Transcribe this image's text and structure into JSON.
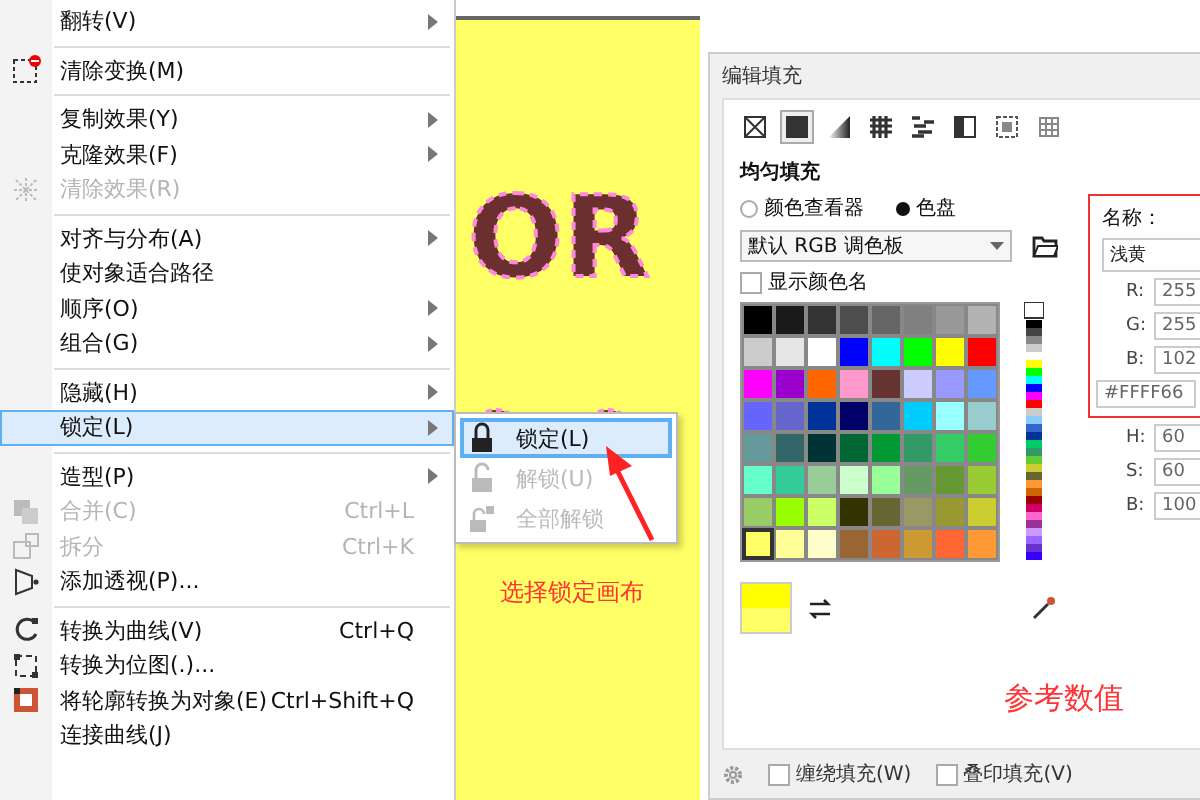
{
  "menu": {
    "groups": [
      [
        {
          "label": "翻转(V)",
          "submenu": true,
          "disabled": false,
          "selected": false
        }
      ],
      [
        {
          "label": "清除变换(M)",
          "submenu": false,
          "disabled": false,
          "selected": false
        }
      ],
      [
        {
          "label": "复制效果(Y)",
          "submenu": true,
          "disabled": false,
          "selected": false
        },
        {
          "label": "克隆效果(F)",
          "submenu": true,
          "disabled": false,
          "selected": false
        },
        {
          "label": "清除效果(R)",
          "submenu": false,
          "disabled": true,
          "selected": false
        }
      ],
      [
        {
          "label": "对齐与分布(A)",
          "submenu": true,
          "disabled": false,
          "selected": false
        },
        {
          "label": "使对象适合路径",
          "submenu": false,
          "disabled": false,
          "selected": false
        },
        {
          "label": "顺序(O)",
          "submenu": true,
          "disabled": false,
          "selected": false
        },
        {
          "label": "组合(G)",
          "submenu": true,
          "disabled": false,
          "selected": false
        }
      ],
      [
        {
          "label": "隐藏(H)",
          "submenu": true,
          "disabled": false,
          "selected": false
        },
        {
          "label": "锁定(L)",
          "submenu": true,
          "disabled": false,
          "selected": true
        }
      ],
      [
        {
          "label": "造型(P)",
          "submenu": true,
          "disabled": false,
          "selected": false
        },
        {
          "label": "合并(C)",
          "shortcut": "Ctrl+L",
          "submenu": false,
          "disabled": true,
          "selected": false
        },
        {
          "label": "拆分",
          "shortcut": "Ctrl+K",
          "submenu": false,
          "disabled": true,
          "selected": false
        },
        {
          "label": "添加透视(P)...",
          "submenu": false,
          "disabled": false,
          "selected": false
        }
      ],
      [
        {
          "label": "转换为曲线(V)",
          "shortcut": "Ctrl+Q",
          "submenu": false,
          "disabled": false,
          "selected": false
        },
        {
          "label": "转换为位图(.)...",
          "submenu": false,
          "disabled": false,
          "selected": false
        },
        {
          "label": "将轮廓转换为对象(E)",
          "shortcut": "Ctrl+Shift+Q",
          "submenu": false,
          "disabled": false,
          "selected": false
        },
        {
          "label": "连接曲线(J)",
          "submenu": false,
          "disabled": false,
          "selected": false
        }
      ]
    ]
  },
  "submenu": {
    "items": [
      {
        "label": "锁定(L)",
        "disabled": false,
        "selected": true
      },
      {
        "label": "解锁(U)",
        "disabled": true,
        "selected": false
      },
      {
        "label": "全部解锁",
        "disabled": true,
        "selected": false
      }
    ]
  },
  "canvas": {
    "artwork_text": "OR",
    "annotation": "选择锁定画布"
  },
  "dialog": {
    "title": "编辑填充",
    "fill_types": [
      {
        "selected": false
      },
      {
        "selected": true
      },
      {
        "selected": false
      },
      {
        "selected": false
      },
      {
        "selected": false
      },
      {
        "selected": false
      },
      {
        "selected": false
      },
      {
        "selected": false
      }
    ],
    "section_title": "均匀填充",
    "modes": [
      {
        "label": "颜色查看器",
        "selected": false
      },
      {
        "label": "色盘",
        "selected": true
      }
    ],
    "palette_name": "默认 RGB 调色板",
    "show_names": {
      "label": "显示颜色名",
      "checked": false
    },
    "swatches": [
      {
        "color": "#000000",
        "selected": false
      },
      {
        "color": "#1a1a1a",
        "selected": false
      },
      {
        "color": "#333333",
        "selected": false
      },
      {
        "color": "#4d4d4d",
        "selected": false
      },
      {
        "color": "#666666",
        "selected": false
      },
      {
        "color": "#808080",
        "selected": false
      },
      {
        "color": "#999999",
        "selected": false
      },
      {
        "color": "#b3b3b3",
        "selected": false
      },
      {
        "color": "#cccccc",
        "selected": false
      },
      {
        "color": "#e6e6e6",
        "selected": false
      },
      {
        "color": "#ffffff",
        "selected": false
      },
      {
        "color": "#0000ff",
        "selected": false
      },
      {
        "color": "#00ffff",
        "selected": false
      },
      {
        "color": "#00ff00",
        "selected": false
      },
      {
        "color": "#ffff00",
        "selected": false
      },
      {
        "color": "#ff0000",
        "selected": false
      },
      {
        "color": "#ff00ff",
        "selected": false
      },
      {
        "color": "#9900cc",
        "selected": false
      },
      {
        "color": "#ff6600",
        "selected": false
      },
      {
        "color": "#ff99cc",
        "selected": false
      },
      {
        "color": "#663333",
        "selected": false
      },
      {
        "color": "#ccccff",
        "selected": false
      },
      {
        "color": "#9999ff",
        "selected": false
      },
      {
        "color": "#6699ff",
        "selected": false
      },
      {
        "color": "#6666ff",
        "selected": false
      },
      {
        "color": "#6666cc",
        "selected": false
      },
      {
        "color": "#003399",
        "selected": false
      },
      {
        "color": "#000066",
        "selected": false
      },
      {
        "color": "#336699",
        "selected": false
      },
      {
        "color": "#00ccff",
        "selected": false
      },
      {
        "color": "#99ffff",
        "selected": false
      },
      {
        "color": "#99cccc",
        "selected": false
      },
      {
        "color": "#669999",
        "selected": false
      },
      {
        "color": "#336666",
        "selected": false
      },
      {
        "color": "#003333",
        "selected": false
      },
      {
        "color": "#006633",
        "selected": false
      },
      {
        "color": "#009933",
        "selected": false
      },
      {
        "color": "#339966",
        "selected": false
      },
      {
        "color": "#33cc66",
        "selected": false
      },
      {
        "color": "#33cc33",
        "selected": false
      },
      {
        "color": "#66ffcc",
        "selected": false
      },
      {
        "color": "#33cc99",
        "selected": false
      },
      {
        "color": "#99cc99",
        "selected": false
      },
      {
        "color": "#ccffcc",
        "selected": false
      },
      {
        "color": "#99ff99",
        "selected": false
      },
      {
        "color": "#669966",
        "selected": false
      },
      {
        "color": "#669933",
        "selected": false
      },
      {
        "color": "#99cc33",
        "selected": false
      },
      {
        "color": "#99cc66",
        "selected": false
      },
      {
        "color": "#99ff00",
        "selected": false
      },
      {
        "color": "#ccff66",
        "selected": false
      },
      {
        "color": "#333300",
        "selected": false
      },
      {
        "color": "#666633",
        "selected": false
      },
      {
        "color": "#999966",
        "selected": false
      },
      {
        "color": "#999933",
        "selected": false
      },
      {
        "color": "#cccc33",
        "selected": false
      },
      {
        "color": "#ffff66",
        "selected": true
      },
      {
        "color": "#ffff99",
        "selected": false
      },
      {
        "color": "#ffffcc",
        "selected": false
      },
      {
        "color": "#996633",
        "selected": false
      },
      {
        "color": "#cc6633",
        "selected": false
      },
      {
        "color": "#cc9933",
        "selected": false
      },
      {
        "color": "#ff6633",
        "selected": false
      },
      {
        "color": "#ff9933",
        "selected": false
      }
    ],
    "name_label": "名称：",
    "name_value": "浅黄",
    "rgb": [
      {
        "label": "R:",
        "value": "255"
      },
      {
        "label": "G:",
        "value": "255"
      },
      {
        "label": "B:",
        "value": "102"
      }
    ],
    "hex": "#FFFF66",
    "hsb": [
      {
        "label": "H:",
        "value": "60"
      },
      {
        "label": "S:",
        "value": "60"
      },
      {
        "label": "B:",
        "value": "100"
      }
    ],
    "annotation": "参考数值",
    "options": [
      {
        "label": "缠绕填充(W)",
        "checked": false
      },
      {
        "label": "叠印填充(V)",
        "checked": false
      }
    ]
  }
}
